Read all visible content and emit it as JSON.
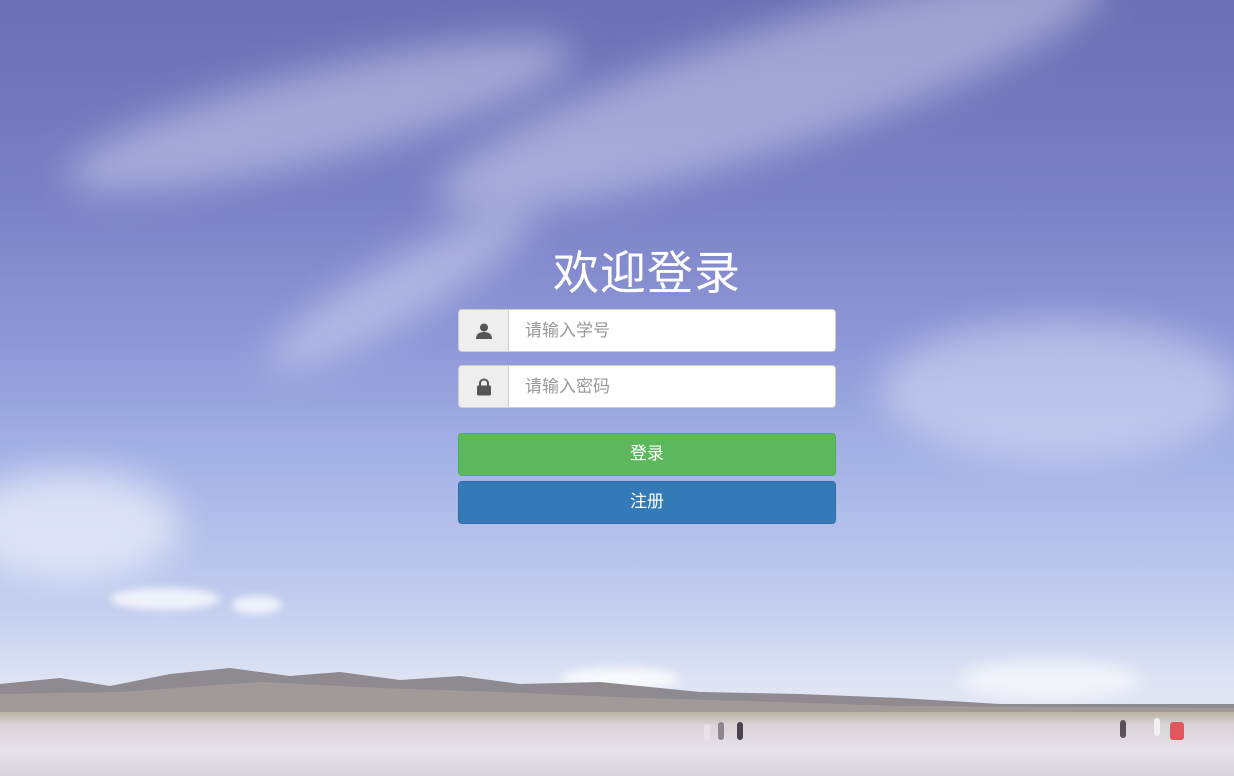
{
  "login": {
    "title": "欢迎登录",
    "username": {
      "placeholder": "请输入学号",
      "value": "",
      "icon": "user-icon"
    },
    "password": {
      "placeholder": "请输入密码",
      "value": "",
      "icon": "lock-icon"
    },
    "login_label": "登录",
    "register_label": "注册"
  },
  "colors": {
    "login_button": "#5cb85c",
    "register_button": "#337ab7",
    "addon_bg": "#eeeeee",
    "title_text": "#ffffff"
  }
}
